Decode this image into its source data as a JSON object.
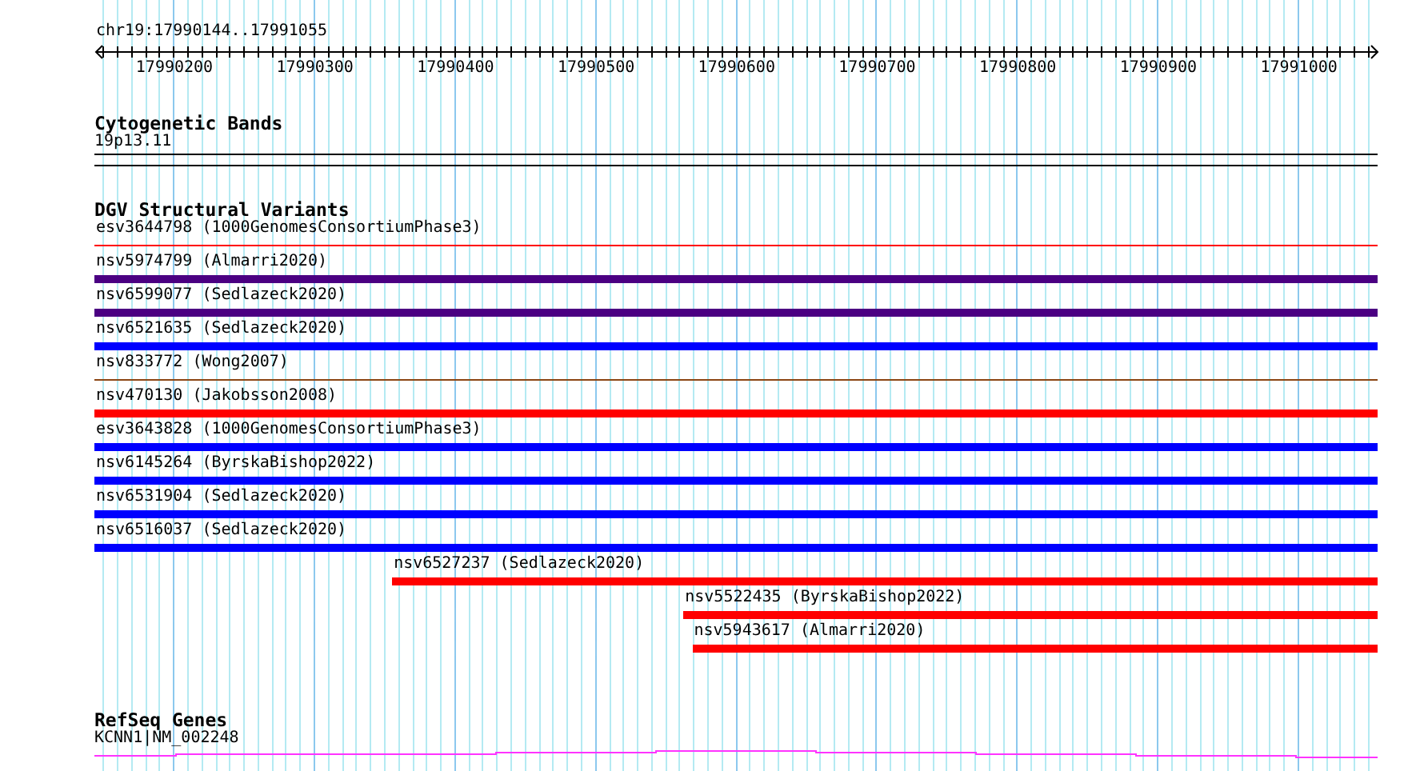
{
  "ruler": {
    "location": "chr19:17990144..17991055",
    "labels": [
      "17990200",
      "17990300",
      "17990400",
      "17990500",
      "17990600",
      "17990700",
      "17990800",
      "17990900",
      "17991000"
    ]
  },
  "cytogenetic_bands": {
    "title": "Cytogenetic Bands",
    "band": "19p13.11"
  },
  "dgv": {
    "title": "DGV Structural Variants",
    "variants": [
      {
        "label": "esv3644798 (1000GenomesConsortiumPhase3)",
        "kind": "thin",
        "color": "#ff0000",
        "level": 1
      },
      {
        "label": "nsv5974799 (Almarri2020)",
        "kind": "thick",
        "color": "#4b0082",
        "level": 1
      },
      {
        "label": "nsv6599077 (Sedlazeck2020)",
        "kind": "thick",
        "color": "#4b0082",
        "level": 1
      },
      {
        "label": "nsv6521635 (Sedlazeck2020)",
        "kind": "thick",
        "color": "#0000ff",
        "level": 1
      },
      {
        "label": "nsv833772 (Wong2007)",
        "kind": "thin",
        "color": "#8b4513",
        "level": 1
      },
      {
        "label": "nsv470130 (Jakobsson2008)",
        "kind": "thick",
        "color": "#ff0000",
        "level": 1
      },
      {
        "label": "esv3643828 (1000GenomesConsortiumPhase3)",
        "kind": "thick",
        "color": "#0000ff",
        "level": 1
      },
      {
        "label": "nsv6145264 (ByrskaBishop2022)",
        "kind": "thick",
        "color": "#0000ff",
        "level": 1
      },
      {
        "label": "nsv6531904 (Sedlazeck2020)",
        "kind": "thick",
        "color": "#0000ff",
        "level": 1
      },
      {
        "label": "nsv6516037 (Sedlazeck2020)",
        "kind": "thick",
        "color": "#0000ff",
        "level": 1
      },
      {
        "label": "nsv6527237 (Sedlazeck2020)",
        "kind": "thick",
        "color": "#ff0000",
        "level": 0.768
      },
      {
        "label": "nsv5522435 (ByrskaBishop2022)",
        "kind": "thick",
        "color": "#ff0000",
        "level": 0.541
      },
      {
        "label": "nsv5943617 (Almarri2020)",
        "kind": "thick",
        "color": "#ff0000",
        "level": 0.534
      }
    ]
  },
  "refseq_genes": {
    "title": "RefSeq Genes",
    "gene": "KCNN1|NM_002248"
  }
}
